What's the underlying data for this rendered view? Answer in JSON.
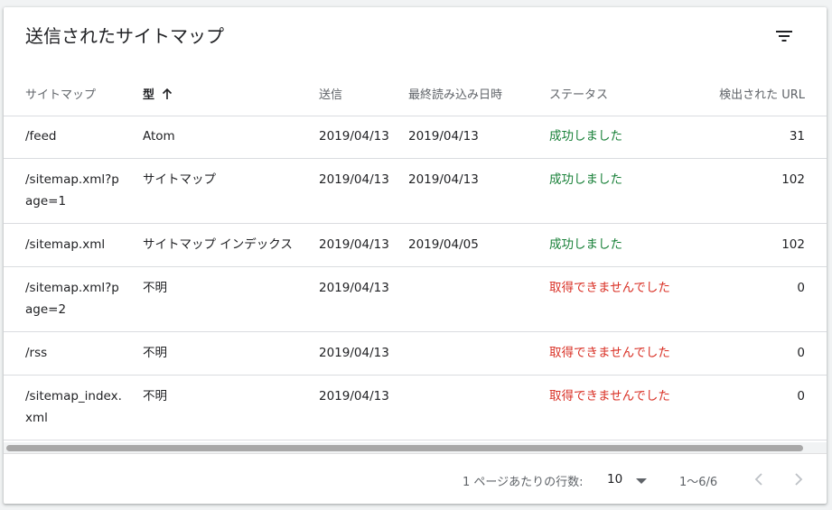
{
  "header": {
    "title": "送信されたサイトマップ",
    "filter_icon": "filter-list-icon"
  },
  "columns": {
    "path": "サイトマップ",
    "type": "型",
    "submitted": "送信",
    "last_read": "最終読み込み日時",
    "status": "ステータス",
    "discovered": "検出された URL"
  },
  "sort": {
    "column": "type",
    "direction": "ascending",
    "icon": "arrow-upward-icon"
  },
  "rows": [
    {
      "path": "/feed",
      "type": "Atom",
      "submitted": "2019/04/13",
      "last_read": "2019/04/13",
      "status": "成功しました",
      "status_kind": "ok",
      "urls": "31"
    },
    {
      "path": "/sitemap.xml?page=1",
      "type": "サイトマップ",
      "submitted": "2019/04/13",
      "last_read": "2019/04/13",
      "status": "成功しました",
      "status_kind": "ok",
      "urls": "102"
    },
    {
      "path": "/sitemap.xml",
      "type": "サイトマップ インデックス",
      "submitted": "2019/04/13",
      "last_read": "2019/04/05",
      "status": "成功しました",
      "status_kind": "ok",
      "urls": "102"
    },
    {
      "path": "/sitemap.xml?page=2",
      "type": "不明",
      "submitted": "2019/04/13",
      "last_read": "",
      "status": "取得できませんでした",
      "status_kind": "err",
      "urls": "0"
    },
    {
      "path": "/rss",
      "type": "不明",
      "submitted": "2019/04/13",
      "last_read": "",
      "status": "取得できませんでした",
      "status_kind": "err",
      "urls": "0"
    },
    {
      "path": "/sitemap_index.xml",
      "type": "不明",
      "submitted": "2019/04/13",
      "last_read": "",
      "status": "取得できませんでした",
      "status_kind": "err",
      "urls": "0"
    }
  ],
  "footer": {
    "rows_per_page_label": "1 ページあたりの行数:",
    "rows_per_page_value": "10",
    "range": "1〜6/6",
    "prev_icon": "chevron-left-icon",
    "next_icon": "chevron-right-icon"
  },
  "colors": {
    "success": "#188038",
    "error": "#d93025",
    "text": "#202124",
    "muted": "#5f6368"
  }
}
